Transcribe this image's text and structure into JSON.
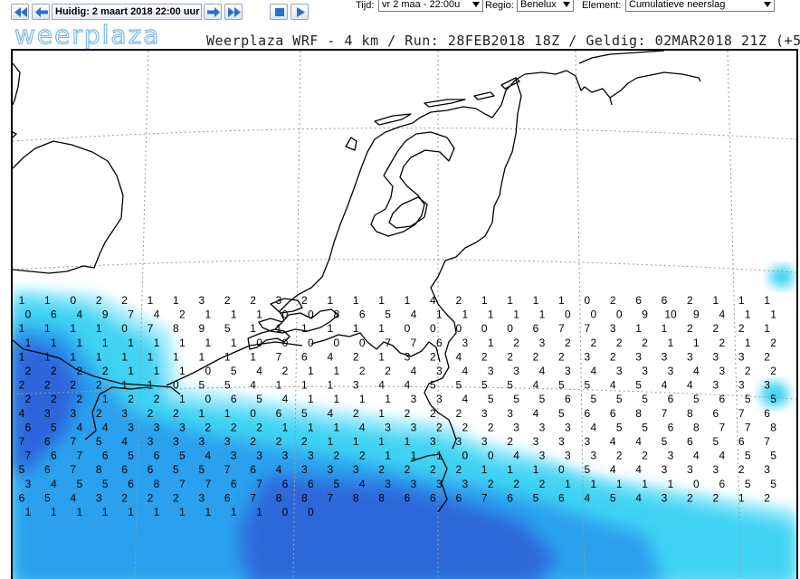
{
  "toolbar": {
    "prev_prev_label": "previous-fast-icon",
    "prev_label": "previous-icon",
    "current_time": "Huidig: 2 maart 2018 22:00 uur",
    "next_label": "next-icon",
    "next_next_label": "next-fast-icon",
    "stop_label": "stop-icon",
    "play_label": "play-icon",
    "tijd_label": "Tijd:",
    "tijd_value": "vr 2 maa - 22:00u",
    "regio_label": "Regio:",
    "regio_value": "Benelux",
    "element_label": "Element:",
    "element_value": "Cumulatieve neerslag"
  },
  "header": {
    "logo": "weerplaza",
    "run_info": "Weerplaza WRF - 4 km / Run: 28FEB2018 18Z / Geldig: 02MAR2018 21Z (+51u)"
  },
  "colors": {
    "accent": "#1e90ff",
    "precip_light": "#b4f0ff",
    "precip_medium": "#3fd3f3",
    "precip_heavy": "#2aa0ee",
    "precip_very_heavy": "#2f5fd8",
    "coastline": "#000000",
    "grid": "#9a9a9a"
  },
  "map": {
    "labels": [
      {
        "v": "1"
      },
      {
        "v": "1"
      },
      {
        "v": "0"
      },
      {
        "v": "2"
      },
      {
        "v": "2"
      },
      {
        "v": "1"
      },
      {
        "v": "1"
      },
      {
        "v": "3"
      },
      {
        "v": "2"
      },
      {
        "v": "2"
      },
      {
        "v": "3"
      },
      {
        "v": "2"
      },
      {
        "v": "1"
      },
      {
        "v": "1"
      },
      {
        "v": "1"
      },
      {
        "v": "1"
      },
      {
        "v": "4"
      },
      {
        "v": "2"
      },
      {
        "v": "1"
      },
      {
        "v": "1"
      },
      {
        "v": "1"
      },
      {
        "v": "1"
      },
      {
        "v": "0"
      },
      {
        "v": "2"
      },
      {
        "v": "6"
      },
      {
        "v": "6"
      },
      {
        "v": "2"
      },
      {
        "v": "1"
      },
      {
        "v": "1"
      },
      {
        "v": "1"
      },
      {
        "v": "0"
      },
      {
        "v": "6"
      },
      {
        "v": "4"
      },
      {
        "v": "9"
      },
      {
        "v": "7"
      },
      {
        "v": "4"
      },
      {
        "v": "2"
      },
      {
        "v": "1"
      },
      {
        "v": "1"
      },
      {
        "v": "1"
      },
      {
        "v": "0"
      },
      {
        "v": "0"
      },
      {
        "v": "8"
      },
      {
        "v": "6"
      },
      {
        "v": "5"
      },
      {
        "v": "4"
      },
      {
        "v": "1"
      },
      {
        "v": "1"
      },
      {
        "v": "1"
      },
      {
        "v": "1"
      },
      {
        "v": "1"
      },
      {
        "v": "0"
      },
      {
        "v": "0"
      },
      {
        "v": "0"
      },
      {
        "v": "9"
      },
      {
        "v": "10"
      },
      {
        "v": "9"
      },
      {
        "v": "4"
      },
      {
        "v": "1"
      },
      {
        "v": "1"
      },
      {
        "v": "1"
      },
      {
        "v": "1"
      },
      {
        "v": "1"
      },
      {
        "v": "1"
      },
      {
        "v": "0"
      },
      {
        "v": "7"
      },
      {
        "v": "8"
      },
      {
        "v": "9"
      },
      {
        "v": "5"
      },
      {
        "v": "1"
      },
      {
        "v": "1"
      },
      {
        "v": "1"
      },
      {
        "v": "1"
      },
      {
        "v": "1"
      },
      {
        "v": "1"
      },
      {
        "v": "0"
      },
      {
        "v": "0"
      },
      {
        "v": "0"
      },
      {
        "v": "0"
      },
      {
        "v": "0"
      },
      {
        "v": "6"
      },
      {
        "v": "7"
      },
      {
        "v": "7"
      },
      {
        "v": "3"
      },
      {
        "v": "1"
      },
      {
        "v": "1"
      },
      {
        "v": "2"
      },
      {
        "v": "2"
      },
      {
        "v": "2"
      },
      {
        "v": "1"
      },
      {
        "v": "1"
      },
      {
        "v": "1"
      },
      {
        "v": "1"
      },
      {
        "v": "1"
      },
      {
        "v": "1"
      },
      {
        "v": "1"
      },
      {
        "v": "1"
      },
      {
        "v": "1"
      },
      {
        "v": "1"
      },
      {
        "v": "0"
      },
      {
        "v": "0"
      },
      {
        "v": "0"
      },
      {
        "v": "0"
      },
      {
        "v": "0"
      },
      {
        "v": "7"
      },
      {
        "v": "7"
      },
      {
        "v": "6"
      },
      {
        "v": "3"
      },
      {
        "v": "1"
      },
      {
        "v": "2"
      },
      {
        "v": "3"
      },
      {
        "v": "2"
      },
      {
        "v": "2"
      },
      {
        "v": "2"
      },
      {
        "v": "2"
      },
      {
        "v": "1"
      },
      {
        "v": "1"
      },
      {
        "v": "2"
      },
      {
        "v": "1"
      },
      {
        "v": "2"
      },
      {
        "v": "1"
      },
      {
        "v": "1"
      },
      {
        "v": "1"
      },
      {
        "v": "1"
      },
      {
        "v": "1"
      },
      {
        "v": "1"
      },
      {
        "v": "1"
      },
      {
        "v": "1"
      },
      {
        "v": "1"
      },
      {
        "v": "1"
      },
      {
        "v": "7"
      },
      {
        "v": "6"
      },
      {
        "v": "4"
      },
      {
        "v": "2"
      },
      {
        "v": "1"
      },
      {
        "v": "3"
      },
      {
        "v": "2"
      },
      {
        "v": "4"
      },
      {
        "v": "2"
      },
      {
        "v": "2"
      },
      {
        "v": "2"
      },
      {
        "v": "2"
      },
      {
        "v": "3"
      },
      {
        "v": "2"
      },
      {
        "v": "3"
      },
      {
        "v": "3"
      },
      {
        "v": "3"
      },
      {
        "v": "3"
      },
      {
        "v": "3"
      },
      {
        "v": "2"
      },
      {
        "v": "2"
      },
      {
        "v": "2"
      },
      {
        "v": "2"
      },
      {
        "v": "2"
      },
      {
        "v": "1"
      },
      {
        "v": "1"
      },
      {
        "v": "1"
      },
      {
        "v": "0"
      },
      {
        "v": "5"
      },
      {
        "v": "4"
      },
      {
        "v": "2"
      },
      {
        "v": "1"
      },
      {
        "v": "1"
      },
      {
        "v": "2"
      },
      {
        "v": "2"
      },
      {
        "v": "4"
      },
      {
        "v": "3"
      },
      {
        "v": "4"
      },
      {
        "v": "3"
      },
      {
        "v": "3"
      },
      {
        "v": "4"
      },
      {
        "v": "3"
      },
      {
        "v": "4"
      },
      {
        "v": "3"
      },
      {
        "v": "3"
      },
      {
        "v": "3"
      },
      {
        "v": "4"
      },
      {
        "v": "3"
      },
      {
        "v": "2"
      },
      {
        "v": "2"
      },
      {
        "v": "2"
      },
      {
        "v": "2"
      },
      {
        "v": "2"
      },
      {
        "v": "2"
      },
      {
        "v": "1"
      },
      {
        "v": "1"
      },
      {
        "v": "0"
      },
      {
        "v": "5"
      },
      {
        "v": "5"
      },
      {
        "v": "4"
      },
      {
        "v": "1"
      },
      {
        "v": "1"
      },
      {
        "v": "1"
      },
      {
        "v": "3"
      },
      {
        "v": "4"
      },
      {
        "v": "4"
      },
      {
        "v": "5"
      },
      {
        "v": "5"
      },
      {
        "v": "5"
      },
      {
        "v": "5"
      },
      {
        "v": "4"
      },
      {
        "v": "5"
      },
      {
        "v": "5"
      },
      {
        "v": "4"
      },
      {
        "v": "5"
      },
      {
        "v": "4"
      },
      {
        "v": "4"
      },
      {
        "v": "3"
      },
      {
        "v": "3"
      },
      {
        "v": "3"
      },
      {
        "v": "2"
      },
      {
        "v": "2"
      },
      {
        "v": "2"
      },
      {
        "v": "1"
      },
      {
        "v": "2"
      },
      {
        "v": "2"
      },
      {
        "v": "1"
      },
      {
        "v": "0"
      },
      {
        "v": "6"
      },
      {
        "v": "5"
      },
      {
        "v": "4"
      },
      {
        "v": "1"
      },
      {
        "v": "1"
      },
      {
        "v": "1"
      },
      {
        "v": "1"
      },
      {
        "v": "3"
      },
      {
        "v": "3"
      },
      {
        "v": "4"
      },
      {
        "v": "5"
      },
      {
        "v": "5"
      },
      {
        "v": "5"
      },
      {
        "v": "6"
      },
      {
        "v": "5"
      },
      {
        "v": "5"
      },
      {
        "v": "5"
      },
      {
        "v": "6"
      },
      {
        "v": "5"
      },
      {
        "v": "6"
      },
      {
        "v": "5"
      },
      {
        "v": "5"
      },
      {
        "v": "4"
      },
      {
        "v": "3"
      },
      {
        "v": "3"
      },
      {
        "v": "2"
      },
      {
        "v": "3"
      },
      {
        "v": "2"
      },
      {
        "v": "2"
      },
      {
        "v": "1"
      },
      {
        "v": "1"
      },
      {
        "v": "0"
      },
      {
        "v": "6"
      },
      {
        "v": "5"
      },
      {
        "v": "4"
      },
      {
        "v": "2"
      },
      {
        "v": "1"
      },
      {
        "v": "2"
      },
      {
        "v": "2"
      },
      {
        "v": "2"
      },
      {
        "v": "3"
      },
      {
        "v": "3"
      },
      {
        "v": "4"
      },
      {
        "v": "5"
      },
      {
        "v": "6"
      },
      {
        "v": "6"
      },
      {
        "v": "8"
      },
      {
        "v": "7"
      },
      {
        "v": "8"
      },
      {
        "v": "6"
      },
      {
        "v": "7"
      },
      {
        "v": "6"
      },
      {
        "v": "6"
      },
      {
        "v": "5"
      },
      {
        "v": "4"
      },
      {
        "v": "4"
      },
      {
        "v": "3"
      },
      {
        "v": "3"
      },
      {
        "v": "3"
      },
      {
        "v": "2"
      },
      {
        "v": "2"
      },
      {
        "v": "2"
      },
      {
        "v": "1"
      },
      {
        "v": "1"
      },
      {
        "v": "1"
      },
      {
        "v": "4"
      },
      {
        "v": "3"
      },
      {
        "v": "3"
      },
      {
        "v": "2"
      },
      {
        "v": "2"
      },
      {
        "v": "2"
      },
      {
        "v": "3"
      },
      {
        "v": "3"
      },
      {
        "v": "3"
      },
      {
        "v": "4"
      },
      {
        "v": "5"
      },
      {
        "v": "5"
      },
      {
        "v": "6"
      },
      {
        "v": "8"
      },
      {
        "v": "7"
      },
      {
        "v": "7"
      },
      {
        "v": "8"
      },
      {
        "v": "7"
      },
      {
        "v": "6"
      },
      {
        "v": "7"
      },
      {
        "v": "5"
      },
      {
        "v": "4"
      },
      {
        "v": "3"
      },
      {
        "v": "3"
      },
      {
        "v": "3"
      },
      {
        "v": "3"
      },
      {
        "v": "2"
      },
      {
        "v": "2"
      },
      {
        "v": "2"
      },
      {
        "v": "1"
      },
      {
        "v": "1"
      },
      {
        "v": "1"
      },
      {
        "v": "1"
      },
      {
        "v": "3"
      },
      {
        "v": "3"
      },
      {
        "v": "3"
      },
      {
        "v": "2"
      },
      {
        "v": "3"
      },
      {
        "v": "3"
      },
      {
        "v": "3"
      },
      {
        "v": "4"
      },
      {
        "v": "4"
      },
      {
        "v": "5"
      },
      {
        "v": "6"
      },
      {
        "v": "5"
      },
      {
        "v": "6"
      },
      {
        "v": "7"
      },
      {
        "v": "7"
      },
      {
        "v": "6"
      },
      {
        "v": "7"
      },
      {
        "v": "6"
      },
      {
        "v": "5"
      },
      {
        "v": "6"
      },
      {
        "v": "5"
      },
      {
        "v": "4"
      },
      {
        "v": "3"
      },
      {
        "v": "3"
      },
      {
        "v": "3"
      },
      {
        "v": "3"
      },
      {
        "v": "2"
      },
      {
        "v": "2"
      },
      {
        "v": "1"
      },
      {
        "v": "1"
      },
      {
        "v": "1"
      },
      {
        "v": "0"
      },
      {
        "v": "0"
      },
      {
        "v": "4"
      },
      {
        "v": "3"
      },
      {
        "v": "3"
      },
      {
        "v": "3"
      },
      {
        "v": "2"
      },
      {
        "v": "2"
      },
      {
        "v": "3"
      },
      {
        "v": "4"
      },
      {
        "v": "4"
      },
      {
        "v": "5"
      },
      {
        "v": "5"
      },
      {
        "v": "5"
      },
      {
        "v": "6"
      },
      {
        "v": "7"
      },
      {
        "v": "8"
      },
      {
        "v": "6"
      },
      {
        "v": "6"
      },
      {
        "v": "5"
      },
      {
        "v": "5"
      },
      {
        "v": "7"
      },
      {
        "v": "6"
      },
      {
        "v": "4"
      },
      {
        "v": "3"
      },
      {
        "v": "3"
      },
      {
        "v": "3"
      },
      {
        "v": "2"
      },
      {
        "v": "2"
      },
      {
        "v": "2"
      },
      {
        "v": "2"
      },
      {
        "v": "1"
      },
      {
        "v": "1"
      },
      {
        "v": "1"
      },
      {
        "v": "0"
      },
      {
        "v": "5"
      },
      {
        "v": "4"
      },
      {
        "v": "4"
      },
      {
        "v": "3"
      },
      {
        "v": "3"
      },
      {
        "v": "3"
      },
      {
        "v": "2"
      },
      {
        "v": "3"
      },
      {
        "v": "3"
      },
      {
        "v": "4"
      },
      {
        "v": "5"
      },
      {
        "v": "5"
      },
      {
        "v": "6"
      },
      {
        "v": "8"
      },
      {
        "v": "7"
      },
      {
        "v": "7"
      },
      {
        "v": "6"
      },
      {
        "v": "7"
      },
      {
        "v": "6"
      },
      {
        "v": "6"
      },
      {
        "v": "5"
      },
      {
        "v": "4"
      },
      {
        "v": "3"
      },
      {
        "v": "3"
      },
      {
        "v": "3"
      },
      {
        "v": "3"
      },
      {
        "v": "2"
      },
      {
        "v": "2"
      },
      {
        "v": "2"
      },
      {
        "v": "1"
      },
      {
        "v": "1"
      },
      {
        "v": "1"
      },
      {
        "v": "1"
      },
      {
        "v": "1"
      },
      {
        "v": "0"
      },
      {
        "v": "6"
      },
      {
        "v": "5"
      },
      {
        "v": "5"
      },
      {
        "v": "6"
      },
      {
        "v": "5"
      },
      {
        "v": "4"
      },
      {
        "v": "3"
      },
      {
        "v": "2"
      },
      {
        "v": "2"
      },
      {
        "v": "2"
      },
      {
        "v": "3"
      },
      {
        "v": "6"
      },
      {
        "v": "7"
      },
      {
        "v": "8"
      },
      {
        "v": "8"
      },
      {
        "v": "7"
      },
      {
        "v": "8"
      },
      {
        "v": "8"
      },
      {
        "v": "6"
      },
      {
        "v": "6"
      },
      {
        "v": "6"
      },
      {
        "v": "7"
      },
      {
        "v": "6"
      },
      {
        "v": "5"
      },
      {
        "v": "6"
      },
      {
        "v": "4"
      },
      {
        "v": "5"
      },
      {
        "v": "4"
      },
      {
        "v": "3"
      },
      {
        "v": "2"
      },
      {
        "v": "2"
      },
      {
        "v": "1"
      },
      {
        "v": "2"
      },
      {
        "v": "1"
      },
      {
        "v": "1"
      },
      {
        "v": "1"
      },
      {
        "v": "1"
      },
      {
        "v": "1"
      },
      {
        "v": "1"
      },
      {
        "v": "1"
      },
      {
        "v": "1"
      },
      {
        "v": "1"
      },
      {
        "v": "1"
      },
      {
        "v": "0"
      },
      {
        "v": "0"
      }
    ]
  }
}
